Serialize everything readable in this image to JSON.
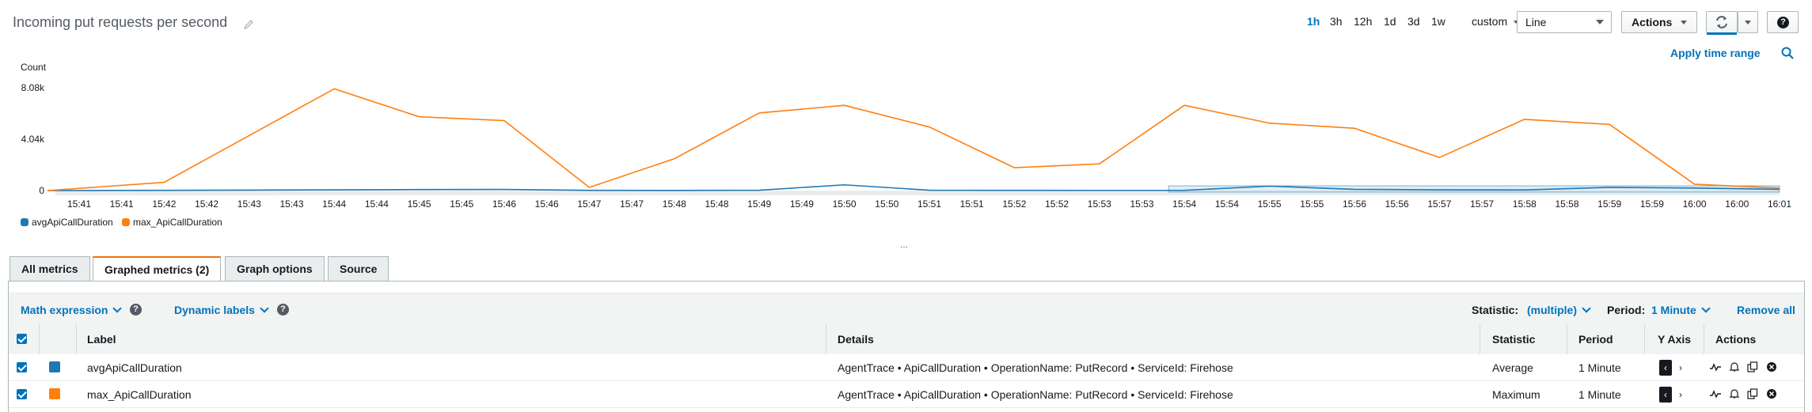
{
  "header": {
    "title": "Incoming put requests per second",
    "time_ranges": [
      "1h",
      "3h",
      "12h",
      "1d",
      "3d",
      "1w"
    ],
    "active_range": "1h",
    "custom_label": "custom",
    "chart_type_select": "Line",
    "actions_label": "Actions",
    "apply_time_range": "Apply time range"
  },
  "chart_data": {
    "type": "line",
    "ylabel": "Count",
    "y_ticks": [
      "0",
      "4.04k",
      "8.08k"
    ],
    "ylim": [
      0,
      8080
    ],
    "grid": false,
    "legend_placement": "bottom-left",
    "x_tick_labels": [
      "15:41",
      "15:41",
      "15:42",
      "15:42",
      "15:43",
      "15:43",
      "15:44",
      "15:44",
      "15:45",
      "15:45",
      "15:46",
      "15:46",
      "15:47",
      "15:47",
      "15:48",
      "15:48",
      "15:49",
      "15:49",
      "15:50",
      "15:50",
      "15:51",
      "15:51",
      "15:52",
      "15:52",
      "15:53",
      "15:53",
      "15:54",
      "15:54",
      "15:55",
      "15:55",
      "15:56",
      "15:56",
      "15:57",
      "15:57",
      "15:58",
      "15:58",
      "15:59",
      "15:59",
      "16:00",
      "16:00",
      "16:01"
    ],
    "x_point_index": [
      0,
      2,
      6,
      8,
      10,
      12,
      14,
      16,
      18,
      20,
      22,
      24,
      26,
      28,
      30,
      32,
      34,
      36,
      38,
      40
    ],
    "series": [
      {
        "name": "avgApiCallDuration",
        "color": "#1f77b4",
        "values": [
          0,
          20,
          60,
          80,
          90,
          20,
          10,
          30,
          450,
          30,
          20,
          15,
          20,
          350,
          100,
          60,
          50,
          250,
          200,
          100
        ]
      },
      {
        "name": "max_ApiCallDuration",
        "color": "#ff7f0e",
        "values": [
          0,
          650,
          8000,
          5800,
          5500,
          250,
          2500,
          6100,
          6700,
          5000,
          1800,
          2100,
          6700,
          5300,
          4900,
          2600,
          5600,
          5200,
          500,
          200
        ]
      }
    ]
  },
  "ellipsis": "...",
  "tabs": [
    {
      "label": "All metrics",
      "active": false
    },
    {
      "label": "Graphed metrics (2)",
      "active": true
    },
    {
      "label": "Graph options",
      "active": false
    },
    {
      "label": "Source",
      "active": false
    }
  ],
  "toolbar": {
    "math_expression": "Math expression",
    "dynamic_labels": "Dynamic labels",
    "statistic_label": "Statistic:",
    "statistic_value": "(multiple)",
    "period_label": "Period:",
    "period_value": "1 Minute",
    "remove_all": "Remove all"
  },
  "table": {
    "headers": {
      "label": "Label",
      "details": "Details",
      "statistic": "Statistic",
      "period": "Period",
      "yaxis": "Y Axis",
      "actions": "Actions"
    },
    "rows": [
      {
        "label": "avgApiCallDuration",
        "color": "#1f77b4",
        "details": "AgentTrace • ApiCallDuration • OperationName: PutRecord • ServiceId: Firehose",
        "statistic": "Average",
        "period": "1 Minute"
      },
      {
        "label": "max_ApiCallDuration",
        "color": "#ff7f0e",
        "details": "AgentTrace • ApiCallDuration • OperationName: PutRecord • ServiceId: Firehose",
        "statistic": "Maximum",
        "period": "1 Minute"
      }
    ]
  }
}
